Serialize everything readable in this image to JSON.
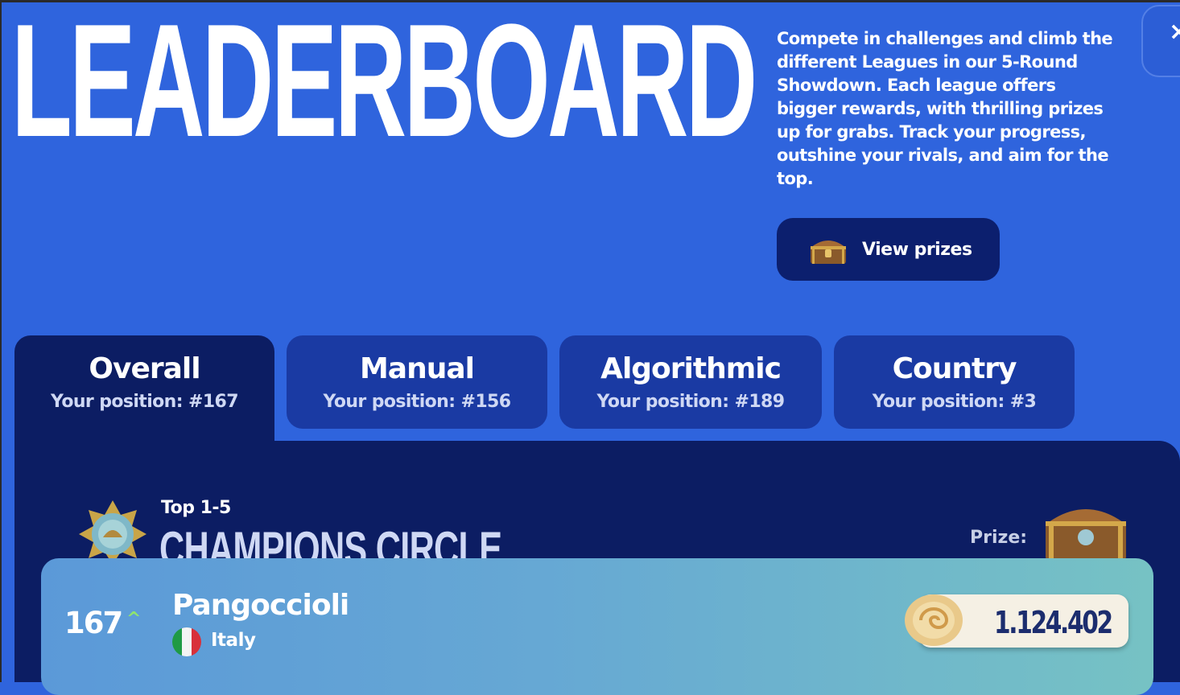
{
  "header": {
    "title": "LEADERBOARD",
    "description": "Compete in challenges and climb the different Leagues in our 5-Round Showdown. Each league offers bigger rewards, with thrilling prizes up for grabs. Track your progress, outshine your rivals, and aim for the top.",
    "view_prizes_label": "View prizes",
    "close_symbol": "×"
  },
  "tabs": [
    {
      "label": "Overall",
      "position": "Your position: #167",
      "active": true
    },
    {
      "label": "Manual",
      "position": "Your position: #156",
      "active": false
    },
    {
      "label": "Algorithmic",
      "position": "Your position: #189",
      "active": false
    },
    {
      "label": "Country",
      "position": "Your position: #3",
      "active": false
    }
  ],
  "group": {
    "subtitle": "Top 1-5",
    "title": "CHAMPIONS CIRCLE",
    "prize_label": "Prize:"
  },
  "player_row": {
    "rank": "167",
    "trend_symbol": "^",
    "name": "Pangoccioli",
    "country": "Italy",
    "score": "1.124.402"
  },
  "colors": {
    "background": "#2f64dd",
    "panel": "#0c1d63",
    "tab_inactive": "#1a3aa3",
    "row_gradient_start": "#5b99d8",
    "row_gradient_end": "#76c2c4",
    "trend_up": "#8fe36f"
  },
  "icons": {
    "close": "close-icon",
    "prizes": "treasure-chest-icon",
    "league": "medal-icon",
    "prize": "treasure-chest-icon",
    "trend": "chevron-up-icon",
    "flag": "italy-flag-icon",
    "score": "seashell-icon"
  }
}
